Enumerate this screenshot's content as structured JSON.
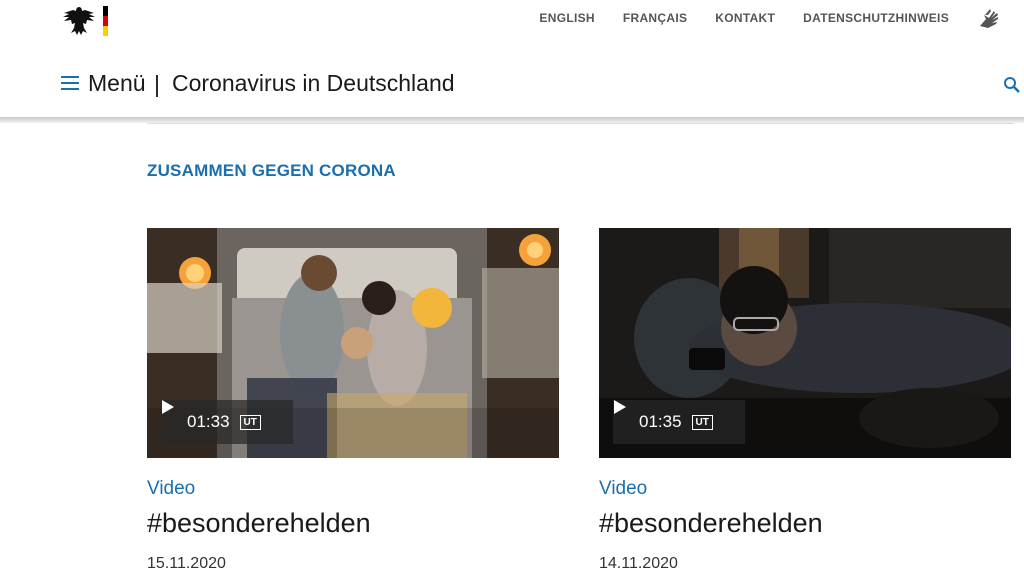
{
  "header": {
    "nav": [
      "ENGLISH",
      "FRANÇAIS",
      "KONTAKT",
      "DATENSCHUTZHINWEIS"
    ],
    "menu_label": "Menü",
    "separator": "|",
    "site_title": "Coronavirus in Deutschland"
  },
  "section": {
    "heading": "ZUSAMMEN GEGEN CORONA"
  },
  "cards": [
    {
      "type": "Video",
      "title": "#besonderehelden",
      "date": "15.11.2020",
      "duration": "01:33",
      "badge": "UT"
    },
    {
      "type": "Video",
      "title": "#besonderehelden",
      "date": "14.11.2020",
      "duration": "01:35",
      "badge": "UT"
    }
  ],
  "colors": {
    "accent": "#1a6fb0",
    "flag": [
      "#000000",
      "#dd0000",
      "#ffce00"
    ]
  },
  "icons": [
    "federal-eagle-icon",
    "sign-language-icon",
    "menu-icon",
    "search-icon",
    "play-icon"
  ]
}
